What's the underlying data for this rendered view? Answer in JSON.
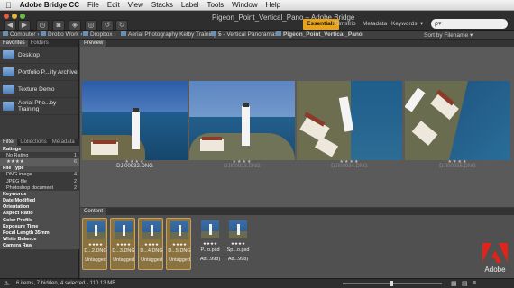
{
  "menubar": {
    "app_name": "Adobe Bridge CC",
    "items": [
      "File",
      "Edit",
      "View",
      "Stacks",
      "Label",
      "Tools",
      "Window",
      "Help"
    ]
  },
  "window": {
    "title": "Pigeon_Point_Vertical_Pano – Adobe Bridge"
  },
  "workspaces": {
    "tabs": [
      "Essentials",
      "Filmstrip",
      "Metadata",
      "Keywords"
    ],
    "active": "Essentials"
  },
  "path_bar": {
    "crumbs": [
      "Computer",
      "Drobo Work",
      "Dropbox",
      "Aerial Photography Kelby Training",
      "5 - Vertical Panoramas",
      "Pigeon_Point_Vertical_Pano"
    ],
    "sort_label": "Sort by Filename"
  },
  "left_panel": {
    "tabs": [
      "Favorites",
      "Folders"
    ],
    "favorites": [
      "Desktop",
      "Portfolio P...lity Archive",
      "Texture Demo",
      "Aerial Pho...by Training"
    ]
  },
  "filter_panel": {
    "tabs": [
      "Filter",
      "Collections",
      "Metadata"
    ],
    "rows": [
      {
        "label": "Ratings",
        "count": "",
        "kind": "head"
      },
      {
        "label": "No Rating",
        "count": "1",
        "kind": "item"
      },
      {
        "label": "★★★★",
        "count": "6",
        "kind": "item"
      },
      {
        "label": "File Type",
        "count": "",
        "kind": "head"
      },
      {
        "label": "DNG image",
        "count": "4",
        "kind": "item"
      },
      {
        "label": "JPEG file",
        "count": "2",
        "kind": "item"
      },
      {
        "label": "Photoshop document",
        "count": "2",
        "kind": "item"
      },
      {
        "label": "Keywords",
        "count": "",
        "kind": "head"
      },
      {
        "label": "Date Modified",
        "count": "",
        "kind": "head"
      },
      {
        "label": "Orientation",
        "count": "",
        "kind": "head"
      },
      {
        "label": "Aspect Ratio",
        "count": "",
        "kind": "head"
      },
      {
        "label": "Color Profile",
        "count": "",
        "kind": "head"
      },
      {
        "label": "Exposure Time",
        "count": "",
        "kind": "head"
      },
      {
        "label": "Focal Length 35mm",
        "count": "",
        "kind": "head"
      },
      {
        "label": "White Balance",
        "count": "",
        "kind": "head"
      },
      {
        "label": "Camera Raw",
        "count": "",
        "kind": "head"
      }
    ]
  },
  "preview": {
    "tab_label": "Preview",
    "items": [
      {
        "filename": "DJI00932.DNG",
        "stars": "★★★★"
      },
      {
        "filename": "DJI00933.DNG",
        "stars": "★★★★"
      },
      {
        "filename": "DJI00934.DNG",
        "stars": "★★★★"
      },
      {
        "filename": "DJI00935.DNG",
        "stars": "★★★★"
      }
    ]
  },
  "content": {
    "tab_label": "Content",
    "thumbs": [
      {
        "name": "D...2.DNG",
        "label": "Untagged",
        "stars": "★★★★"
      },
      {
        "name": "D...3.DNG",
        "label": "Untagged",
        "stars": "★★★★"
      },
      {
        "name": "D...4.DNG",
        "label": "Untagged",
        "stars": "★★★★"
      },
      {
        "name": "D...5.DNG",
        "label": "Untagged",
        "stars": "★★★★"
      },
      {
        "name": "P...o.psd",
        "label": "Ad...998)",
        "stars": "★★★★"
      },
      {
        "name": "Sp...o.psd",
        "label": "Ad...998)",
        "stars": "★★★★"
      }
    ]
  },
  "status": {
    "text": "6 items, 7 hidden, 4 selected - 110.13 MB"
  },
  "search": {
    "placeholder": "ρ▾"
  },
  "brand": {
    "logo_text": "Adobe"
  },
  "colors": {
    "accent": "#e8a31a",
    "adobe_red": "#e2231a"
  }
}
